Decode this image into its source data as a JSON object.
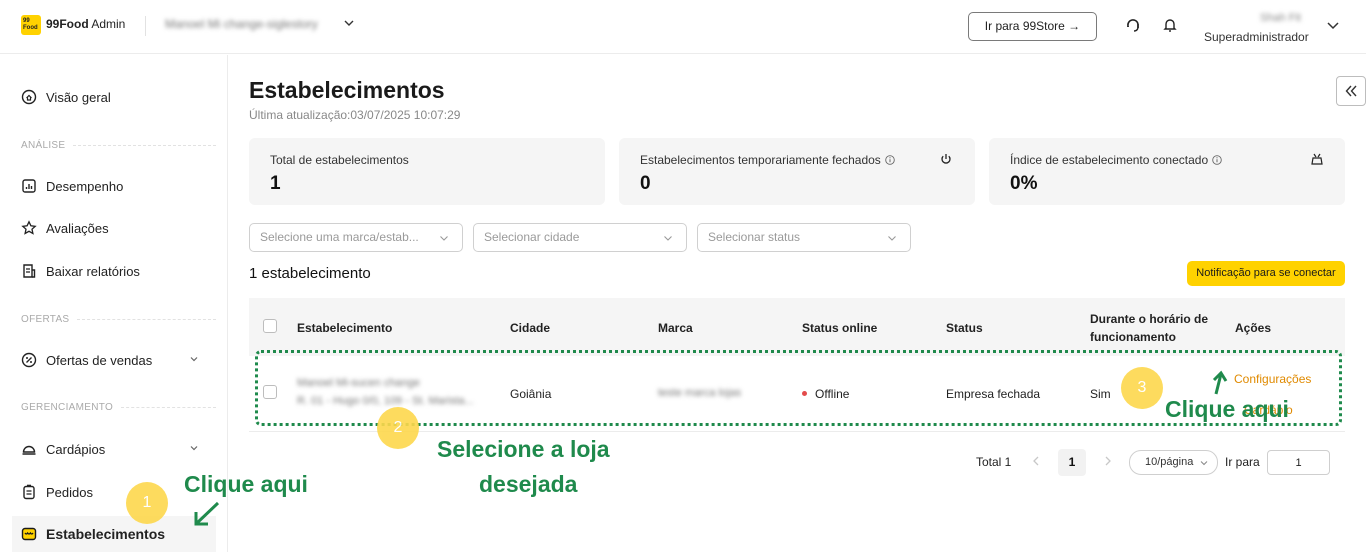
{
  "header": {
    "logo_text": "99 Food",
    "app_brand": "99Food",
    "app_suffix": "Admin",
    "store_name": "Manoel Mi change-siglestory",
    "store_button": "Ir para 99Store →",
    "user_name": "Shah Fit",
    "user_role": "Superadministrador"
  },
  "sidebar": {
    "items": [
      {
        "label": "Visão geral",
        "icon": "home-icon"
      },
      {
        "label": "Desempenho",
        "icon": "chart-icon"
      },
      {
        "label": "Avaliações",
        "icon": "star-icon"
      },
      {
        "label": "Baixar relatórios",
        "icon": "report-icon"
      },
      {
        "label": "Ofertas de vendas",
        "icon": "discount-icon"
      },
      {
        "label": "Cardápios",
        "icon": "cloche-icon"
      },
      {
        "label": "Pedidos",
        "icon": "clipboard-icon"
      },
      {
        "label": "Estabelecimentos",
        "icon": "store-icon"
      }
    ],
    "sections": {
      "analysis": "ANÁLISE",
      "offers": "OFERTAS",
      "management": "GERENCIAMENTO"
    }
  },
  "main": {
    "title": "Estabelecimentos",
    "last_update": "Última atualização:03/07/2025 10:07:29",
    "cards": [
      {
        "label": "Total de estabelecimentos",
        "value": "1"
      },
      {
        "label": "Estabelecimentos temporariamente fechados",
        "value": "0"
      },
      {
        "label": "Índice de estabelecimento conectado",
        "value": "0%"
      }
    ],
    "filters": [
      {
        "placeholder": "Selecione uma marca/estab..."
      },
      {
        "placeholder": "Selecionar cidade"
      },
      {
        "placeholder": "Selecionar status"
      }
    ],
    "count_text": "1 estabelecimento",
    "notify_button": "Notificação para se conectar"
  },
  "table": {
    "headers": {
      "establishment": "Estabelecimento",
      "city": "Cidade",
      "brand": "Marca",
      "online_status": "Status online",
      "status": "Status",
      "hours_line1": "Durante o horário de",
      "hours_line2": "funcionamento",
      "actions": "Ações"
    },
    "rows": [
      {
        "name": "Manoel Mi-sucen change",
        "address": "R. 01 - Hugo 0/0, 109 - St. Marista...",
        "city": "Goiânia",
        "brand": "teste marca lojas",
        "online_status": "Offline",
        "status": "Empresa fechada",
        "during_hours": "Sim",
        "action_primary": "Configurações",
        "action_secondary": "Cardápio"
      }
    ]
  },
  "pagination": {
    "total": "Total 1",
    "current_page": "1",
    "page_size": "10/página",
    "goto_label": "Ir para",
    "goto_value": "1"
  },
  "annotations": {
    "step1": "1",
    "step2": "2",
    "step3": "3",
    "click_here_1": "Clique aqui",
    "select_line1": "Selecione a loja",
    "select_line2": "desejada",
    "click_here_3": "Clique aqui"
  }
}
